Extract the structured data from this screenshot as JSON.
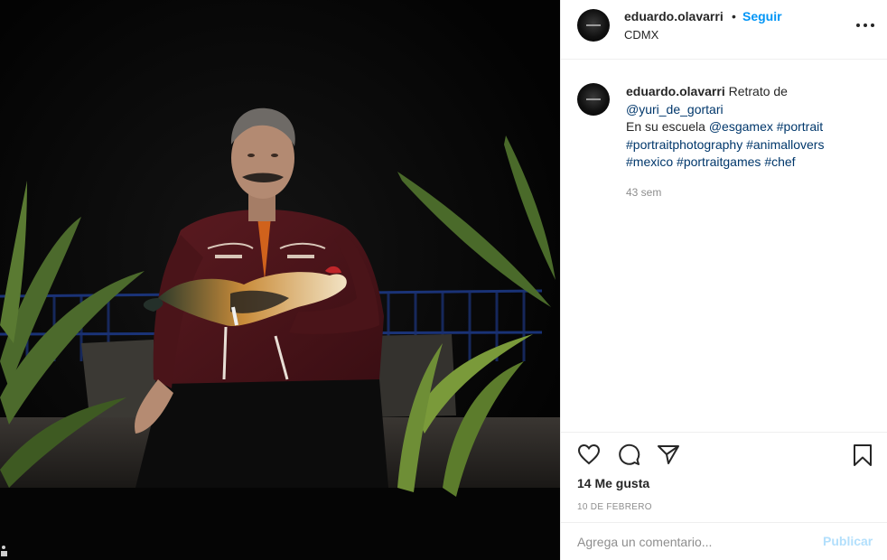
{
  "post": {
    "username": "eduardo.olavarri",
    "separator": "•",
    "follow_label": "Seguir",
    "location": "CDMX",
    "more_icon": "more-horizontal-icon"
  },
  "caption": {
    "username": "eduardo.olavarri",
    "text_1": " Retrato de ",
    "mention_1": "@yuri_de_gortari",
    "text_2": "En su escuela ",
    "mention_2": "@esgamex",
    "hashtags": [
      "#portrait",
      "#portraitphotography",
      "#animallovers",
      "#mexico",
      "#portraitgames",
      "#chef"
    ],
    "time": "43 sem"
  },
  "actions": {
    "icons": [
      "heart-icon",
      "comment-icon",
      "share-icon",
      "bookmark-icon"
    ],
    "likes": "14 Me gusta",
    "date": "10 DE FEBRERO"
  },
  "comment_box": {
    "placeholder": "Agrega un comentario...",
    "publish_label": "Publicar"
  },
  "colors": {
    "link": "#0095f6",
    "hashtag": "#00376b",
    "muted": "#8e8e8e",
    "publish_disabled": "#b2dffc"
  }
}
